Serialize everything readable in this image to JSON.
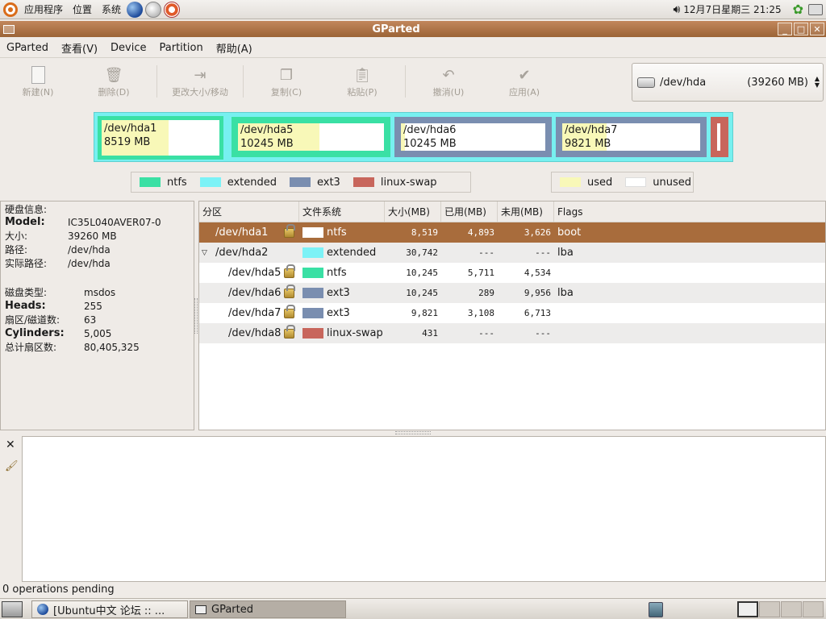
{
  "top_panel": {
    "menus": [
      "应用程序",
      "位置",
      "系统"
    ],
    "clock": "12月7日星期三 21:25"
  },
  "window": {
    "title": "GParted"
  },
  "menubar": [
    "GParted",
    "查看(V)",
    "Device",
    "Partition",
    "帮助(A)"
  ],
  "toolbar": [
    {
      "label": "新建(N)",
      "icon": "new-icon"
    },
    {
      "label": "删除(D)",
      "icon": "delete-icon"
    },
    {
      "label": "更改大小/移动",
      "icon": "resize-icon"
    },
    {
      "label": "复制(C)",
      "icon": "copy-icon"
    },
    {
      "label": "粘贴(P)",
      "icon": "paste-icon"
    },
    {
      "label": "撤消(U)",
      "icon": "undo-icon"
    },
    {
      "label": "应用(A)",
      "icon": "apply-icon"
    }
  ],
  "device_selector": {
    "device": "/dev/hda",
    "size": "(39260 MB)"
  },
  "partition_map": [
    {
      "name": "/dev/hda1",
      "size": "8519 MB",
      "fs": "ntfs",
      "used_fraction": 0.57
    },
    {
      "name": "/dev/hda5",
      "size": "10245 MB",
      "fs": "ntfs",
      "used_fraction": 0.56
    },
    {
      "name": "/dev/hda6",
      "size": "10245 MB",
      "fs": "ext3",
      "used_fraction": 0.03
    },
    {
      "name": "/dev/hda7",
      "size": "9821 MB",
      "fs": "ext3",
      "used_fraction": 0.32
    }
  ],
  "legend_fs": [
    {
      "label": "ntfs",
      "color": "#3ae0a4"
    },
    {
      "label": "extended",
      "color": "#7cf2f6"
    },
    {
      "label": "ext3",
      "color": "#7a8eb0"
    },
    {
      "label": "linux-swap",
      "color": "#c8665c"
    }
  ],
  "legend_usage": [
    {
      "label": "used",
      "color": "#f8f8b8"
    },
    {
      "label": "unused",
      "color": "#ffffff"
    }
  ],
  "disk_info": {
    "title": "硬盘信息:",
    "rows": [
      {
        "k": "Model:",
        "v": "IC35L040AVER07-0"
      },
      {
        "k": "大小:",
        "v": "39260 MB"
      },
      {
        "k": "路径:",
        "v": "/dev/hda"
      },
      {
        "k": "实际路径:",
        "v": "/dev/hda"
      }
    ],
    "rows2": [
      {
        "k": "磁盘类型:",
        "v": "msdos"
      },
      {
        "k": "Heads:",
        "v": "255"
      },
      {
        "k": "扇区/磁道数:",
        "v": "63"
      },
      {
        "k": "Cylinders:",
        "v": "5,005"
      },
      {
        "k": "总计扇区数:",
        "v": "80,405,325"
      }
    ]
  },
  "table": {
    "headers": [
      "分区",
      "文件系统",
      "大小(MB)",
      "已用(MB)",
      "未用(MB)",
      "Flags"
    ],
    "rows": [
      {
        "part": "/dev/hda1",
        "fs": "ntfs",
        "color": "#ffffff",
        "size": "8,519",
        "used": "4,893",
        "unused": "3,626",
        "flags": "boot"
      },
      {
        "part": "/dev/hda2",
        "fs": "extended",
        "color": "#7cf2f6",
        "size": "30,742",
        "used": "---",
        "unused": "---",
        "flags": "lba"
      },
      {
        "part": "/dev/hda5",
        "fs": "ntfs",
        "color": "#3ae0a4",
        "size": "10,245",
        "used": "5,711",
        "unused": "4,534",
        "flags": ""
      },
      {
        "part": "/dev/hda6",
        "fs": "ext3",
        "color": "#7a8eb0",
        "size": "10,245",
        "used": "289",
        "unused": "9,956",
        "flags": "lba"
      },
      {
        "part": "/dev/hda7",
        "fs": "ext3",
        "color": "#7a8eb0",
        "size": "9,821",
        "used": "3,108",
        "unused": "6,713",
        "flags": ""
      },
      {
        "part": "/dev/hda8",
        "fs": "linux-swap",
        "color": "#c8665c",
        "size": "431",
        "used": "---",
        "unused": "---",
        "flags": ""
      }
    ]
  },
  "status": "0 operations pending",
  "taskbar": {
    "tasks": [
      "[Ubuntu中文 论坛 :: ...",
      "GParted"
    ]
  }
}
